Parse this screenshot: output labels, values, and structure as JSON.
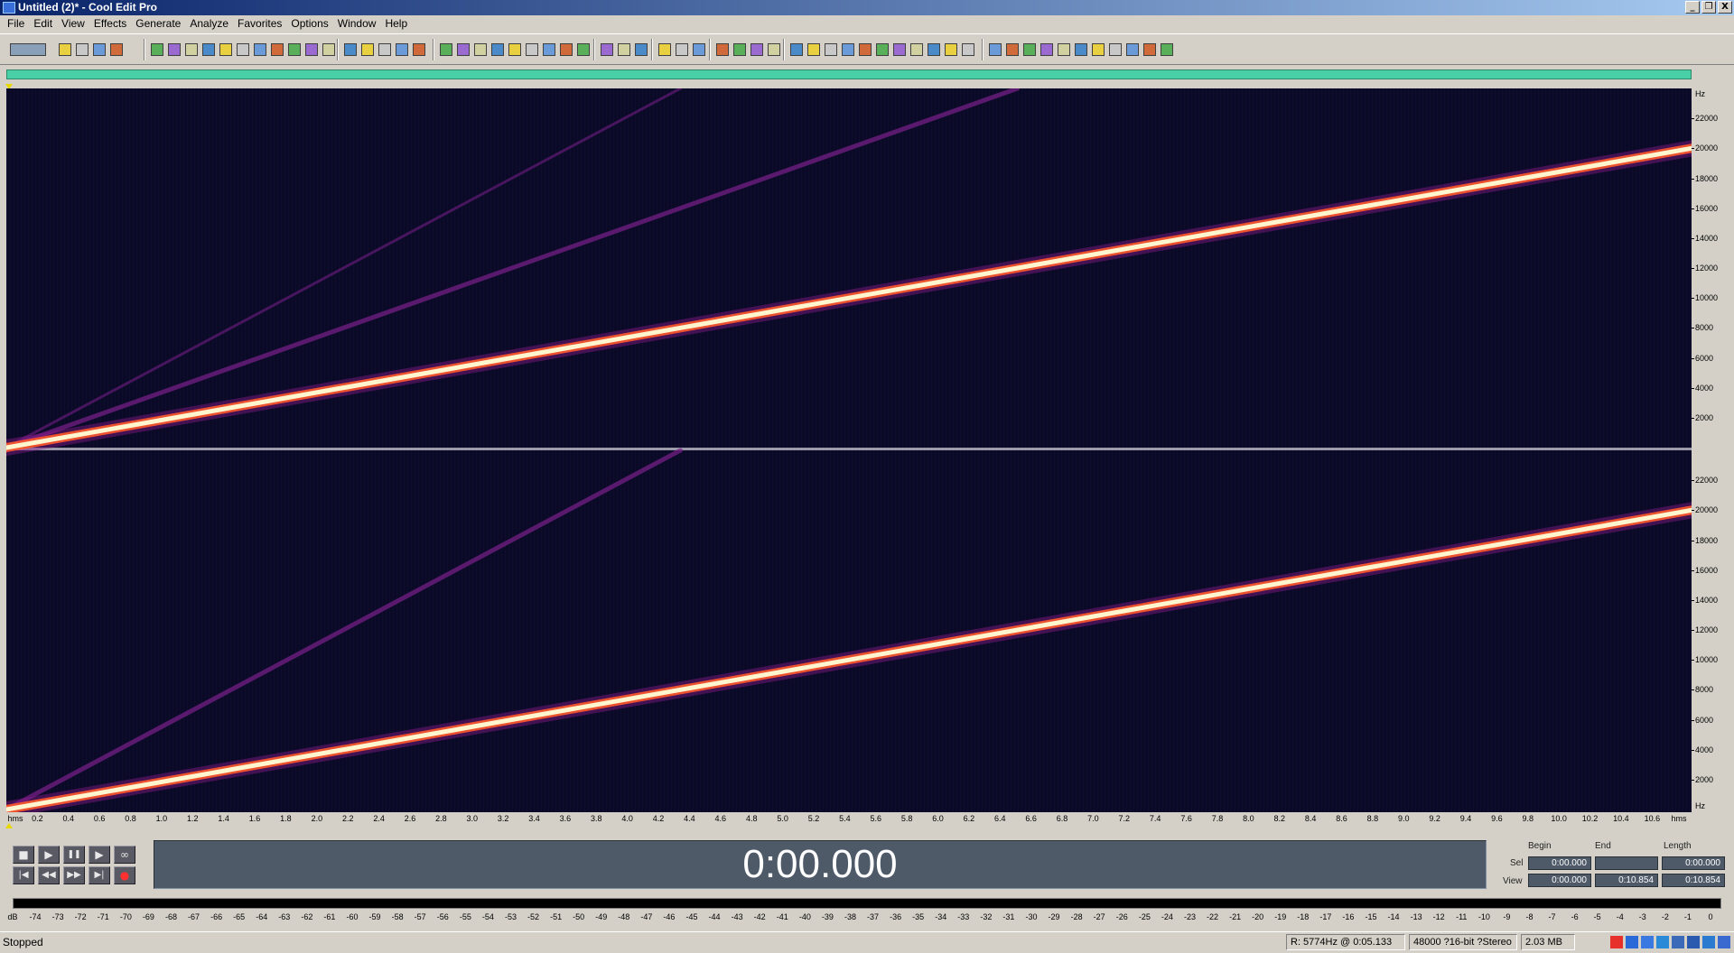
{
  "window": {
    "title": "Untitled (2)* - Cool Edit Pro",
    "controls": [
      "_",
      "❐",
      "X"
    ]
  },
  "menu": [
    "File",
    "Edit",
    "View",
    "Effects",
    "Generate",
    "Analyze",
    "Favorites",
    "Options",
    "Window",
    "Help"
  ],
  "frequency_axis": {
    "unit_label": "Hz",
    "ticks": [
      "22000",
      "20000",
      "18000",
      "16000",
      "14000",
      "12000",
      "10000",
      "8000",
      "6000",
      "4000",
      "2000"
    ]
  },
  "time_axis": {
    "start_label": "hms",
    "end_label": "hms",
    "ticks": [
      "0.2",
      "0.4",
      "0.6",
      "0.8",
      "1.0",
      "1.2",
      "1.4",
      "1.6",
      "1.8",
      "2.0",
      "2.2",
      "2.4",
      "2.6",
      "2.8",
      "3.0",
      "3.2",
      "3.4",
      "3.6",
      "3.8",
      "4.0",
      "4.2",
      "4.4",
      "4.6",
      "4.8",
      "5.0",
      "5.2",
      "5.4",
      "5.6",
      "5.8",
      "6.0",
      "6.2",
      "6.4",
      "6.6",
      "6.8",
      "7.0",
      "7.2",
      "7.4",
      "7.6",
      "7.8",
      "8.0",
      "8.2",
      "8.4",
      "8.6",
      "8.8",
      "9.0",
      "9.2",
      "9.4",
      "9.6",
      "9.8",
      "10.0",
      "10.2",
      "10.4",
      "10.6"
    ]
  },
  "spectrogram": {
    "duration_s": 10.854,
    "max_hz": 24000,
    "sweep_end_hz": 20000,
    "harmonic_end_hz": [
      20000,
      40000,
      60000
    ],
    "colors": {
      "background": "#0a0a26",
      "peak": "#fff6d0",
      "mid": "#ff5a2a",
      "glow": "#8a1a8a",
      "harmonic": "#7a1f8a"
    }
  },
  "transport": {
    "stop": "■",
    "play": "▶",
    "pause": "❚❚",
    "play_to_end": "▶",
    "loop": "∞",
    "go_start": "|◀",
    "rewind": "◀◀",
    "forward": "▶▶",
    "go_end": "▶|",
    "record": "●"
  },
  "time_display": "0:00.000",
  "selection": {
    "headers": {
      "begin": "Begin",
      "end": "End",
      "length": "Length"
    },
    "sel": {
      "label": "Sel",
      "begin": "0:00.000",
      "end": "",
      "length": "0:00.000"
    },
    "view": {
      "label": "View",
      "begin": "0:00.000",
      "end": "0:10.854",
      "length": "0:10.854"
    }
  },
  "level_meter": {
    "labels": [
      "dB",
      "-74",
      "-73",
      "-72",
      "-71",
      "-70",
      "-69",
      "-68",
      "-67",
      "-66",
      "-65",
      "-64",
      "-63",
      "-62",
      "-61",
      "-60",
      "-59",
      "-58",
      "-57",
      "-56",
      "-55",
      "-54",
      "-53",
      "-52",
      "-51",
      "-50",
      "-49",
      "-48",
      "-47",
      "-46",
      "-45",
      "-44",
      "-43",
      "-42",
      "-41",
      "-40",
      "-39",
      "-38",
      "-37",
      "-36",
      "-35",
      "-34",
      "-33",
      "-32",
      "-31",
      "-30",
      "-29",
      "-28",
      "-27",
      "-26",
      "-25",
      "-24",
      "-23",
      "-22",
      "-21",
      "-20",
      "-19",
      "-18",
      "-17",
      "-16",
      "-15",
      "-14",
      "-13",
      "-12",
      "-11",
      "-10",
      "-9",
      "-8",
      "-7",
      "-6",
      "-5",
      "-4",
      "-3",
      "-2",
      "-1",
      "0"
    ]
  },
  "status": {
    "state": "Stopped",
    "cursor_readout": "R: 5774Hz @   0:05.133",
    "format": "48000 ?16-bit ?Stereo",
    "size": "2.03 MB"
  }
}
